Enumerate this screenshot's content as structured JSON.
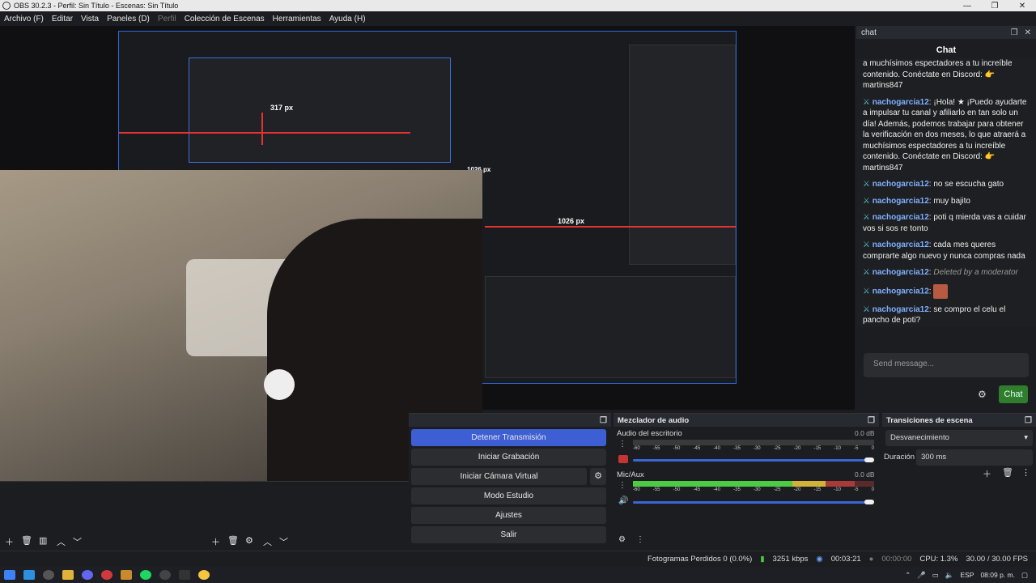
{
  "window": {
    "title": "OBS 30.2.3 - Perfil: Sin Título - Escenas: Sin Título",
    "controls": [
      "—",
      "❐",
      "✕"
    ]
  },
  "menu": [
    {
      "label": "Archivo (F)",
      "enabled": true
    },
    {
      "label": "Editar",
      "enabled": true
    },
    {
      "label": "Vista",
      "enabled": true
    },
    {
      "label": "Paneles (D)",
      "enabled": true
    },
    {
      "label": "Perfil",
      "enabled": false
    },
    {
      "label": "Colección de Escenas",
      "enabled": true
    },
    {
      "label": "Herramientas",
      "enabled": true
    },
    {
      "label": "Ayuda (H)",
      "enabled": true
    }
  ],
  "preview": {
    "measure_1": "317 px",
    "measure_2": "1026 px",
    "measure_3": "1026 px"
  },
  "chat": {
    "dock_title": "chat",
    "title": "Chat",
    "messages": [
      {
        "user": "",
        "text": "a muchísimos espectadores a tu increíble contenido. Conéctate en Discord: 👉 martins847"
      },
      {
        "user": "nachogarcia12",
        "text": "¡Hola! ★ ¡Puedo ayudarte a impulsar tu canal y afiliarlo en tan solo un día! Además, podemos trabajar para obtener la verificación en dos meses, lo que atraerá a muchísimos espectadores a tu increíble contenido. Conéctate en Discord: 👉 martins847"
      },
      {
        "user": "nachogarcia12",
        "text": "no se escucha gato"
      },
      {
        "user": "nachogarcia12",
        "text": "muy bajito"
      },
      {
        "user": "nachogarcia12",
        "text": "poti q mierda vas a cuidar vos si sos re tonto"
      },
      {
        "user": "nachogarcia12",
        "text": "cada mes queres comprarte algo nuevo y nunca compras nada"
      },
      {
        "user": "nachogarcia12",
        "text": "Deleted by a moderator",
        "deleted": true
      },
      {
        "user": "nachogarcia12",
        "text": "",
        "emote": true
      },
      {
        "user": "nachogarcia12",
        "text": "se compro el celu el pancho de poti?"
      }
    ],
    "input_placeholder": "Send message...",
    "send_button": "Chat"
  },
  "controls": {
    "buttons": [
      {
        "label": "Detener Transmisión",
        "active": true
      },
      {
        "label": "Iniciar Grabación",
        "active": false
      },
      {
        "label": "Iniciar Cámara Virtual",
        "active": false
      },
      {
        "label": "Modo Estudio",
        "active": false
      },
      {
        "label": "Ajustes",
        "active": false
      },
      {
        "label": "Salir",
        "active": false
      }
    ]
  },
  "mixer": {
    "title": "Mezclador de audio",
    "channels": [
      {
        "name": "Audio del escritorio",
        "db": "0.0 dB",
        "level": 0.0,
        "muted": true
      },
      {
        "name": "Mic/Aux",
        "db": "0.0 dB",
        "level": 0.92,
        "muted": false
      }
    ],
    "scale": [
      "-60",
      "-55",
      "-50",
      "-45",
      "-40",
      "-35",
      "-30",
      "-25",
      "-20",
      "-15",
      "-10",
      "-5",
      "0"
    ]
  },
  "transitions": {
    "title": "Transiciones de escena",
    "selected": "Desvanecimiento",
    "duration_label": "Duración",
    "duration_value": "300 ms"
  },
  "status": {
    "frames_dropped": "Fotogramas Perdidos 0 (0.0%)",
    "bitrate": "3251 kbps",
    "stream_time": "00:03:21",
    "rec_time": "00:00:00",
    "cpu": "CPU: 1.3%",
    "fps": "30.00 / 30.00 FPS"
  },
  "taskbar": {
    "lang": "ESP",
    "time": "08:09 p. m."
  },
  "colors": {
    "accent": "#3d5fd3",
    "chat_button": "#2f7d2d",
    "username": "#7fb0ff",
    "meter_green": "#4ccb43",
    "meter_yellow": "#d3b23a",
    "meter_red": "#d33a3a"
  }
}
